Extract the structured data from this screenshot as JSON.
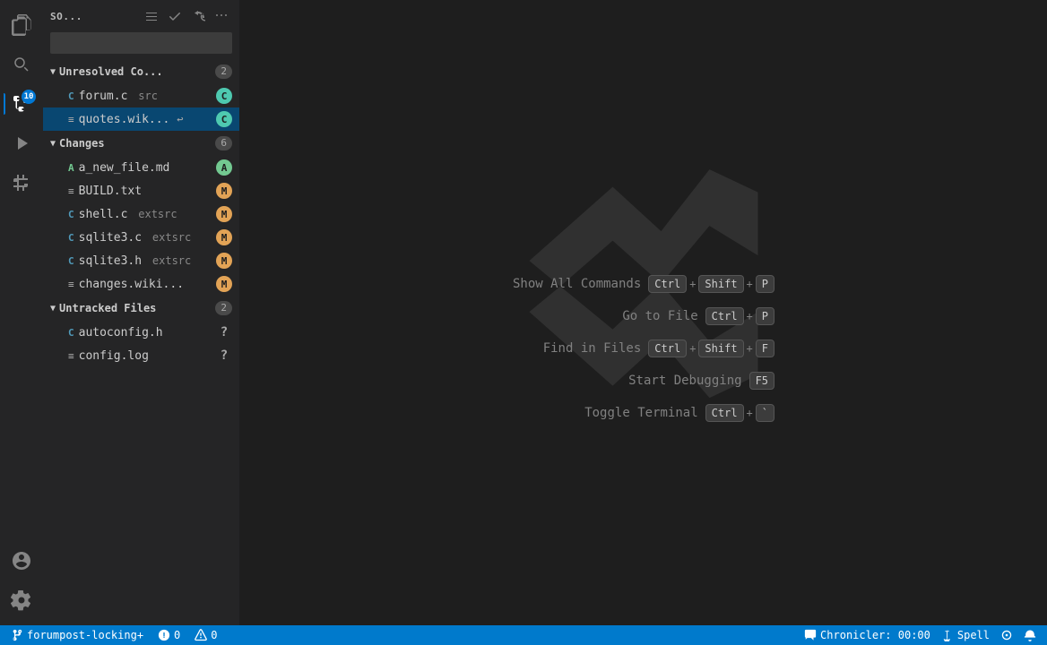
{
  "sidebar": {
    "title": "SO...",
    "search_placeholder": "",
    "sections": {
      "unresolved": {
        "label": "Unresolved Co...",
        "count": 2,
        "files": [
          {
            "name": "forum.c",
            "ext": "src",
            "icon": "C",
            "badge": "C",
            "badge_type": "c"
          },
          {
            "name": "quotes.wik...",
            "ext": "",
            "has_undo": true,
            "badge": "C",
            "badge_type": "c"
          }
        ]
      },
      "changes": {
        "label": "Changes",
        "count": 6,
        "files": [
          {
            "name": "a_new_file.md",
            "ext": "",
            "icon": "A",
            "badge": "A",
            "badge_type": "a"
          },
          {
            "name": "BUILD.txt",
            "ext": "",
            "icon": "txt",
            "badge": "M",
            "badge_type": "m"
          },
          {
            "name": "shell.c",
            "ext": "extsrc",
            "icon": "C",
            "badge": "M",
            "badge_type": "m"
          },
          {
            "name": "sqlite3.c",
            "ext": "extsrc",
            "icon": "C",
            "badge": "M",
            "badge_type": "m"
          },
          {
            "name": "sqlite3.h",
            "ext": "extsrc",
            "icon": "C",
            "badge": "M",
            "badge_type": "m"
          },
          {
            "name": "changes.wiki...",
            "ext": "",
            "icon": "txt",
            "badge": "M",
            "badge_type": "m"
          }
        ]
      },
      "untracked": {
        "label": "Untracked Files",
        "count": 2,
        "files": [
          {
            "name": "autoconfig.h",
            "ext": "",
            "icon": "C",
            "badge": "?",
            "badge_type": "q"
          },
          {
            "name": "config.log",
            "ext": "",
            "icon": "txt",
            "badge": "?",
            "badge_type": "q"
          }
        ]
      }
    }
  },
  "shortcuts": [
    {
      "label": "Show All Commands",
      "keys": [
        "Ctrl",
        "+",
        "Shift",
        "+",
        "P"
      ]
    },
    {
      "label": "Go to File",
      "keys": [
        "Ctrl",
        "+",
        "P"
      ]
    },
    {
      "label": "Find in Files",
      "keys": [
        "Ctrl",
        "+",
        "Shift",
        "+",
        "F"
      ]
    },
    {
      "label": "Start Debugging",
      "keys": [
        "F5"
      ]
    },
    {
      "label": "Toggle Terminal",
      "keys": [
        "Ctrl",
        "+",
        "`"
      ]
    }
  ],
  "status_bar": {
    "branch": "forumpost-locking+",
    "errors": "0",
    "warnings": "0",
    "chronicler": "Chronicler: 00:00",
    "spell": "Spell"
  },
  "activity": {
    "explorer_label": "Explorer",
    "search_label": "Search",
    "source_control_label": "Source Control",
    "run_label": "Run",
    "extensions_label": "Extensions",
    "account_label": "Account",
    "settings_label": "Settings"
  }
}
